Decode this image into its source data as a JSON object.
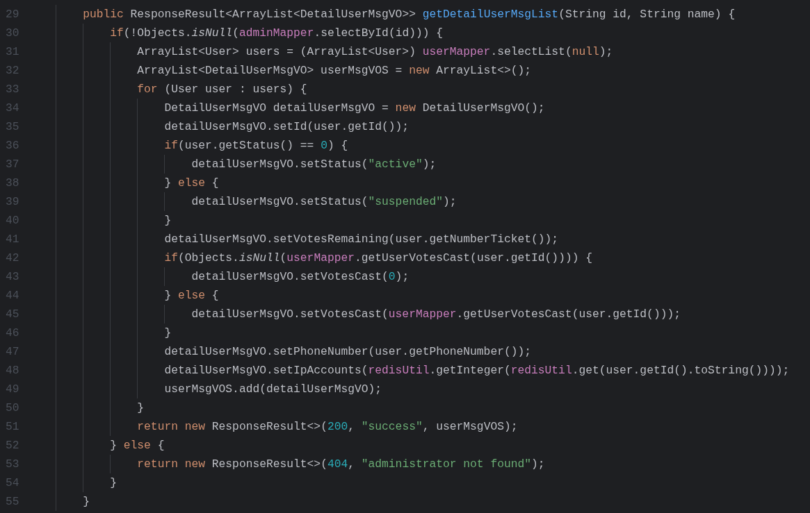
{
  "editor": {
    "lines": [
      {
        "number": "29",
        "tokens": [
          {
            "text": "        public",
            "kind": "keyword"
          },
          {
            "text": " ResponseResult<ArrayList<DetailUserMsgVO>> ",
            "kind": "plain"
          },
          {
            "text": "getDetailUserMsgList",
            "kind": "declaration"
          },
          {
            "text": "(String id, String name) {",
            "kind": "plain"
          }
        ]
      },
      {
        "number": "30",
        "tokens": [
          {
            "text": "            if",
            "kind": "keyword"
          },
          {
            "text": "(!Objects.",
            "kind": "plain"
          },
          {
            "text": "isNull",
            "kind": "static"
          },
          {
            "text": "(",
            "kind": "plain"
          },
          {
            "text": "adminMapper",
            "kind": "field"
          },
          {
            "text": ".selectById(id))) {",
            "kind": "plain"
          }
        ]
      },
      {
        "number": "31",
        "tokens": [
          {
            "text": "                ArrayList<User> users = (ArrayList<User>) ",
            "kind": "plain"
          },
          {
            "text": "userMapper",
            "kind": "field"
          },
          {
            "text": ".selectList(",
            "kind": "plain"
          },
          {
            "text": "null",
            "kind": "keyword"
          },
          {
            "text": ");",
            "kind": "plain"
          }
        ]
      },
      {
        "number": "32",
        "tokens": [
          {
            "text": "                ArrayList<DetailUserMsgVO> userMsgVOS = ",
            "kind": "plain"
          },
          {
            "text": "new",
            "kind": "keyword"
          },
          {
            "text": " ArrayList<>();",
            "kind": "plain"
          }
        ]
      },
      {
        "number": "33",
        "tokens": [
          {
            "text": "                for",
            "kind": "keyword"
          },
          {
            "text": " (User user : users) {",
            "kind": "plain"
          }
        ]
      },
      {
        "number": "34",
        "tokens": [
          {
            "text": "                    DetailUserMsgVO detailUserMsgVO = ",
            "kind": "plain"
          },
          {
            "text": "new",
            "kind": "keyword"
          },
          {
            "text": " DetailUserMsgVO();",
            "kind": "plain"
          }
        ]
      },
      {
        "number": "35",
        "tokens": [
          {
            "text": "                    detailUserMsgVO.setId(user.getId());",
            "kind": "plain"
          }
        ]
      },
      {
        "number": "36",
        "tokens": [
          {
            "text": "                    if",
            "kind": "keyword"
          },
          {
            "text": "(user.getStatus() == ",
            "kind": "plain"
          },
          {
            "text": "0",
            "kind": "number"
          },
          {
            "text": ") {",
            "kind": "plain"
          }
        ]
      },
      {
        "number": "37",
        "tokens": [
          {
            "text": "                        detailUserMsgVO.setStatus(",
            "kind": "plain"
          },
          {
            "text": "\"active\"",
            "kind": "string"
          },
          {
            "text": ");",
            "kind": "plain"
          }
        ]
      },
      {
        "number": "38",
        "tokens": [
          {
            "text": "                    } ",
            "kind": "plain"
          },
          {
            "text": "else",
            "kind": "keyword"
          },
          {
            "text": " {",
            "kind": "plain"
          }
        ]
      },
      {
        "number": "39",
        "tokens": [
          {
            "text": "                        detailUserMsgVO.setStatus(",
            "kind": "plain"
          },
          {
            "text": "\"suspended\"",
            "kind": "string"
          },
          {
            "text": ");",
            "kind": "plain"
          }
        ]
      },
      {
        "number": "40",
        "tokens": [
          {
            "text": "                    }",
            "kind": "plain"
          }
        ]
      },
      {
        "number": "41",
        "tokens": [
          {
            "text": "                    detailUserMsgVO.setVotesRemaining(user.getNumberTicket());",
            "kind": "plain"
          }
        ]
      },
      {
        "number": "42",
        "tokens": [
          {
            "text": "                    if",
            "kind": "keyword"
          },
          {
            "text": "(Objects.",
            "kind": "plain"
          },
          {
            "text": "isNull",
            "kind": "static"
          },
          {
            "text": "(",
            "kind": "plain"
          },
          {
            "text": "userMapper",
            "kind": "field"
          },
          {
            "text": ".getUserVotesCast(user.getId()))) {",
            "kind": "plain"
          }
        ]
      },
      {
        "number": "43",
        "tokens": [
          {
            "text": "                        detailUserMsgVO.setVotesCast(",
            "kind": "plain"
          },
          {
            "text": "0",
            "kind": "number"
          },
          {
            "text": ");",
            "kind": "plain"
          }
        ]
      },
      {
        "number": "44",
        "tokens": [
          {
            "text": "                    } ",
            "kind": "plain"
          },
          {
            "text": "else",
            "kind": "keyword"
          },
          {
            "text": " {",
            "kind": "plain"
          }
        ]
      },
      {
        "number": "45",
        "tokens": [
          {
            "text": "                        detailUserMsgVO.setVotesCast(",
            "kind": "plain"
          },
          {
            "text": "userMapper",
            "kind": "field"
          },
          {
            "text": ".getUserVotesCast(user.getId()));",
            "kind": "plain"
          }
        ]
      },
      {
        "number": "46",
        "tokens": [
          {
            "text": "                    }",
            "kind": "plain"
          }
        ]
      },
      {
        "number": "47",
        "tokens": [
          {
            "text": "                    detailUserMsgVO.setPhoneNumber(user.getPhoneNumber());",
            "kind": "plain"
          }
        ]
      },
      {
        "number": "48",
        "tokens": [
          {
            "text": "                    detailUserMsgVO.setIpAccounts(",
            "kind": "plain"
          },
          {
            "text": "redisUtil",
            "kind": "field"
          },
          {
            "text": ".getInteger(",
            "kind": "plain"
          },
          {
            "text": "redisUtil",
            "kind": "field"
          },
          {
            "text": ".get(user.getId().toString())));",
            "kind": "plain"
          }
        ]
      },
      {
        "number": "49",
        "tokens": [
          {
            "text": "                    userMsgVOS.add(detailUserMsgVO);",
            "kind": "plain"
          }
        ]
      },
      {
        "number": "50",
        "tokens": [
          {
            "text": "                }",
            "kind": "plain"
          }
        ]
      },
      {
        "number": "51",
        "tokens": [
          {
            "text": "                return new",
            "kind": "keyword"
          },
          {
            "text": " ResponseResult<>(",
            "kind": "plain"
          },
          {
            "text": "200",
            "kind": "number"
          },
          {
            "text": ", ",
            "kind": "plain"
          },
          {
            "text": "\"success\"",
            "kind": "string"
          },
          {
            "text": ", userMsgVOS);",
            "kind": "plain"
          }
        ]
      },
      {
        "number": "52",
        "tokens": [
          {
            "text": "            } ",
            "kind": "plain"
          },
          {
            "text": "else",
            "kind": "keyword"
          },
          {
            "text": " {",
            "kind": "plain"
          }
        ]
      },
      {
        "number": "53",
        "tokens": [
          {
            "text": "                return new",
            "kind": "keyword"
          },
          {
            "text": " ResponseResult<>(",
            "kind": "plain"
          },
          {
            "text": "404",
            "kind": "number"
          },
          {
            "text": ", ",
            "kind": "plain"
          },
          {
            "text": "\"administrator not found\"",
            "kind": "string"
          },
          {
            "text": ");",
            "kind": "plain"
          }
        ]
      },
      {
        "number": "54",
        "tokens": [
          {
            "text": "            }",
            "kind": "plain"
          }
        ]
      },
      {
        "number": "55",
        "tokens": [
          {
            "text": "        }",
            "kind": "plain"
          }
        ]
      }
    ]
  }
}
